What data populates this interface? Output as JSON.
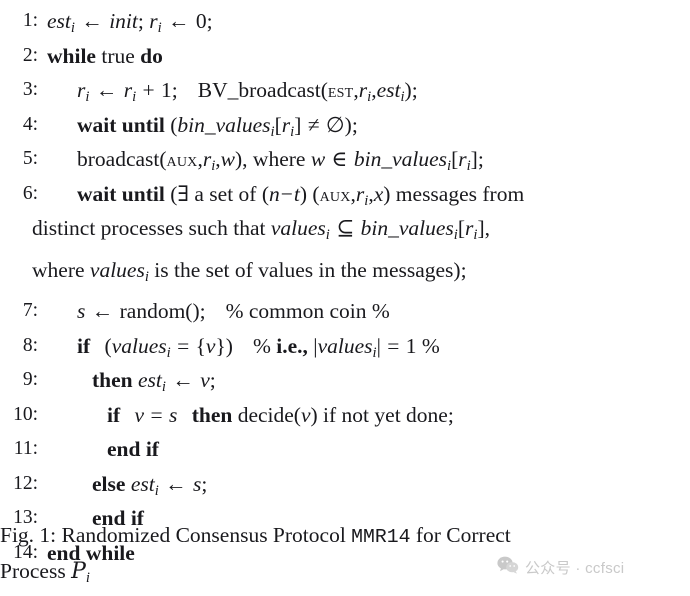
{
  "figure": {
    "type": "algorithm-pseudocode",
    "caption": {
      "label": "Fig. 1:",
      "line1_pre": "Randomized Consensus Protocol",
      "line1_mono": "MMR14",
      "line1_post": "for Correct",
      "line2_pre": "Process",
      "line2_symbol": "P",
      "line2_subscript": "i"
    },
    "lines": [
      {
        "num": "1",
        "indent": 0,
        "text": "est_i ← init; r_i ← 0;"
      },
      {
        "num": "2",
        "indent": 0,
        "text": "while true do"
      },
      {
        "num": "3",
        "indent": 1,
        "text": "r_i ← r_i + 1;   BV_broadcast(EST,r_i,est_i);"
      },
      {
        "num": "4",
        "indent": 1,
        "text": "wait until (bin_values_i[r_i] ≠ ∅);"
      },
      {
        "num": "5",
        "indent": 1,
        "text": "broadcast(AUX,r_i,w), where w ∈ bin_values_i[r_i];"
      },
      {
        "num": "6",
        "indent": 1,
        "text": "wait until (∃ a set of (n−t) (AUX,r_i,x) messages from distinct processes such that values_i ⊆ bin_values_i[r_i], where values_i is the set of values in the messages);"
      },
      {
        "num": "7",
        "indent": 1,
        "text": "s ← random();   % common coin %"
      },
      {
        "num": "8",
        "indent": 1,
        "text": "if  (values_i = {v})    % i.e., |values_i| = 1 %"
      },
      {
        "num": "9",
        "indent": 2,
        "text": "then est_i ← v;"
      },
      {
        "num": "10",
        "indent": 3,
        "text": "if  v = s  then decide(v) if not yet done;"
      },
      {
        "num": "11",
        "indent": 3,
        "text": "end if"
      },
      {
        "num": "12",
        "indent": 2,
        "text": "else est_i ← s;"
      },
      {
        "num": "13",
        "indent": 2,
        "text": "end if"
      },
      {
        "num": "14",
        "indent": 0,
        "text": "end while"
      }
    ],
    "tokens": {
      "keyword_while": "while",
      "keyword_true": "true",
      "keyword_do": "do",
      "keyword_wait": "wait",
      "keyword_until": "until",
      "keyword_if": "if",
      "keyword_then": "then",
      "keyword_else": "else",
      "keyword_end": "end",
      "ident_est": "est",
      "ident_init": "init",
      "ident_r": "r",
      "ident_s": "s",
      "ident_v": "v",
      "ident_w": "w",
      "ident_x": "x",
      "ident_n": "n",
      "ident_t": "t",
      "ident_values": "values",
      "ident_bin_values": "bin_values",
      "sub_i": "i",
      "num_zero": "0",
      "num_one": "1",
      "call_bv_broadcast": "BV_broadcast",
      "call_broadcast": "broadcast",
      "call_random": "random()",
      "call_decide": "decide",
      "tag_est": "EST",
      "tag_aux": "AUX",
      "arrow": "←",
      "neq": "≠",
      "emptyset": "∅",
      "in": "∈",
      "subseteq": "⊆",
      "exists": "∃",
      "eq": "=",
      "plus": "+",
      "minus": "−",
      "percent": "%",
      "comment_coin": "common coin",
      "comment_ie": "i.e.,",
      "text_where": "where",
      "text_a_set_of": "a set of",
      "text_messages_from": "messages from",
      "text_distinct_processes": "distinct processes such that",
      "text_is_the_set": "is the set of values in the messages);",
      "text_if_not_yet_done": "if not yet done;"
    }
  },
  "watermark": {
    "icon": "wechat-icon",
    "text": "公众号 · ccfsci",
    "color": "#c9c9c9"
  },
  "colors": {
    "background": "#ffffff",
    "text": "#19191d",
    "watermark": "#c9c9c9"
  }
}
